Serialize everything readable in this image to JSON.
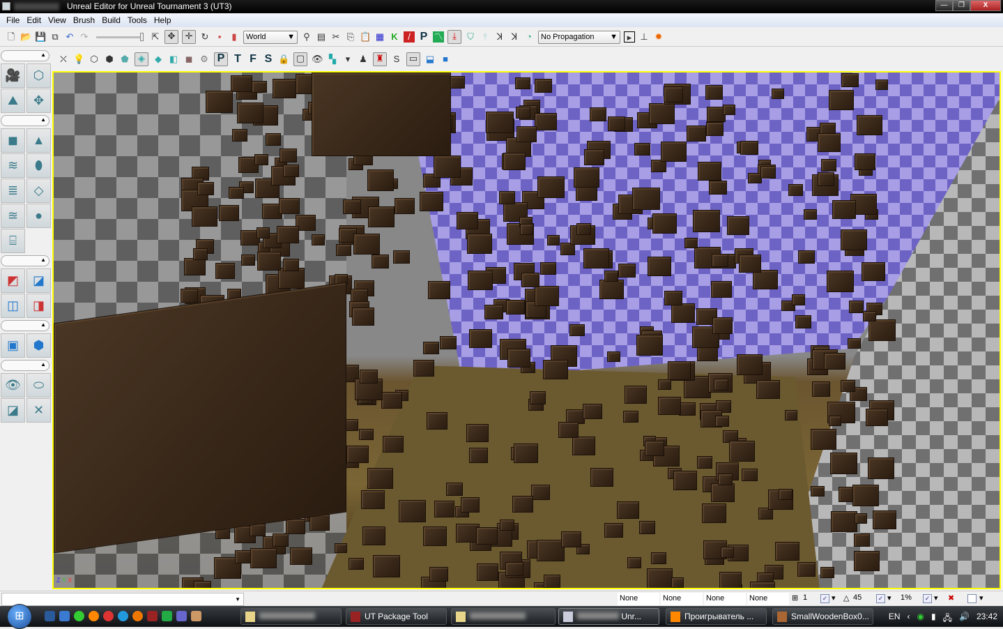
{
  "window": {
    "title": "Unreal Editor for Unreal Tournament 3 (UT3)",
    "minimize": "—",
    "restore": "❐",
    "close": "X"
  },
  "menu": [
    "File",
    "Edit",
    "View",
    "Brush",
    "Build",
    "Tools",
    "Help"
  ],
  "toolbar": {
    "coordinate_system": "World",
    "propagation": "No Propagation",
    "view_letters": [
      "P",
      "T",
      "F",
      "S"
    ],
    "realtime_letter": "P",
    "show_label": "S"
  },
  "viewport": {
    "border_color": "#ffff00",
    "axis_labels": [
      "X",
      "Y",
      "Z"
    ]
  },
  "statusbar": {
    "command_input": "",
    "fields": [
      "None",
      "None",
      "None",
      "None"
    ],
    "grid_size": "1",
    "rotation_snap": "45",
    "scale_snap": "1%"
  },
  "taskbar": {
    "tasks": [
      {
        "label": "",
        "blurred": true
      },
      {
        "label": "UT Package Tool",
        "blurred": false
      },
      {
        "label": "",
        "blurred": true
      },
      {
        "label": "Unr...",
        "blurred": true
      },
      {
        "label": "Проигрыватель ...",
        "blurred": false
      },
      {
        "label": "SmallWoodenBox0...",
        "blurred": false
      }
    ],
    "language": "EN",
    "clock": "23:42"
  }
}
